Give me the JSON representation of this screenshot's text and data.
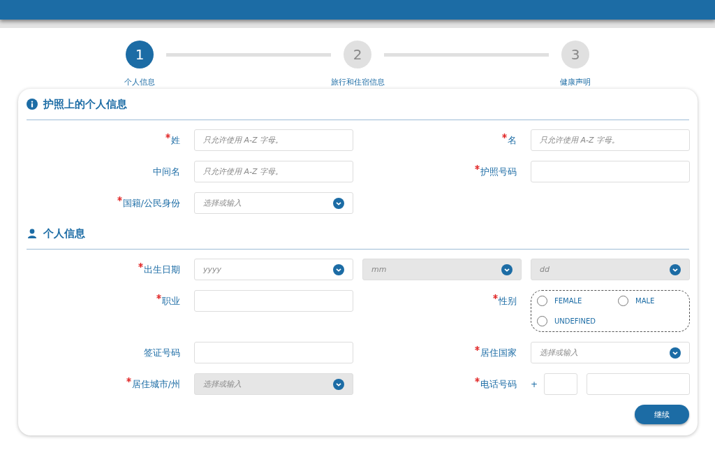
{
  "steps": [
    {
      "number": "1",
      "label": "个人信息",
      "selected": true
    },
    {
      "number": "2",
      "label": "旅行和住宿信息",
      "selected": false
    },
    {
      "number": "3",
      "label": "健康声明",
      "selected": false
    }
  ],
  "sections": [
    {
      "title": "护照上的个人信息",
      "rows": [
        {
          "left": {
            "kind": "text",
            "label": "姓",
            "required": true,
            "placeholder": "只允许使用 A-Z 字母。"
          },
          "right": {
            "kind": "text",
            "label": "名",
            "required": true,
            "placeholder": "只允许使用 A-Z 字母。"
          }
        },
        {
          "left": {
            "kind": "text",
            "label": "中间名",
            "required": false,
            "placeholder": "只允许使用 A-Z 字母。"
          },
          "right": {
            "kind": "text",
            "label": "护照号码",
            "required": true
          }
        },
        {
          "left": {
            "kind": "select",
            "label": "国籍/公民身份",
            "required": true,
            "placeholder": "选择或输入",
            "disabled": false
          },
          "right": null
        }
      ]
    },
    {
      "title": "个人信息",
      "rows": [
        {
          "left": {
            "kind": "date",
            "label": "出生日期",
            "required": true,
            "parts": [
              {
                "placeholder": "yyyy",
                "disabled": false
              },
              {
                "placeholder": "mm",
                "disabled": true
              },
              {
                "placeholder": "dd",
                "disabled": true
              }
            ]
          },
          "right": null
        },
        {
          "left": {
            "kind": "text",
            "label": "职业",
            "required": true
          },
          "right": {
            "kind": "radio",
            "label": "性别",
            "required": true,
            "options": [
              {
                "label": "FEMALE",
                "selected": false
              },
              {
                "label": "MALE",
                "selected": false
              },
              {
                "label": "UNDEFINED",
                "selected": false
              }
            ]
          }
        },
        {
          "left": {
            "kind": "text",
            "label": "签证号码",
            "required": false
          },
          "right": {
            "kind": "select",
            "label": "居住国家",
            "required": true,
            "placeholder": "选择或输入",
            "disabled": false
          }
        },
        {
          "left": {
            "kind": "select",
            "label": "居住城市/州",
            "required": true,
            "placeholder": "选择或输入",
            "disabled": true
          },
          "right": {
            "kind": "phone",
            "label": "电话号码",
            "required": true,
            "prefix": "+"
          }
        }
      ]
    }
  ],
  "continue_button": "继续"
}
